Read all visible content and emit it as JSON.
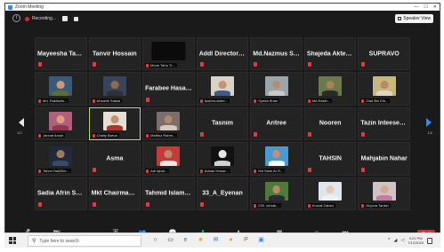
{
  "window": {
    "title": "Zoom Meeting"
  },
  "topbar": {
    "recording_label": "Recording...",
    "view_label": "Speaker View"
  },
  "gallery": {
    "tiles": [
      {
        "name": "Mayeesha Tasn...",
        "display": "text",
        "muted": true
      },
      {
        "name": "Tanvir Hossain",
        "display": "text",
        "muted": true
      },
      {
        "name": "Moon Tahu Tr...",
        "display": "video",
        "muted": true,
        "bg": "#0b0b0b",
        "skin": "#0b0b0b",
        "shirt": "#0b0b0b"
      },
      {
        "name": "Addl Director C...",
        "display": "text",
        "muted": true
      },
      {
        "name": "Md.Nazmus Sh...",
        "display": "text",
        "muted": true
      },
      {
        "name": "Shajeda Akter S...",
        "display": "text",
        "muted": true
      },
      {
        "name": "SUPRAVO",
        "display": "text",
        "muted": true
      },
      {
        "name": "Md. Rakibulis...",
        "display": "video",
        "muted": true,
        "bg": "#3b5a7a",
        "skin": "#c79a78",
        "shirt": "#5b6f3a"
      },
      {
        "name": "Ahsanik Saikat",
        "display": "video",
        "muted": true,
        "bg": "#36455a",
        "skin": "#8f6a4d",
        "shirt": "#2f2f3a"
      },
      {
        "name": "Farabee Hasan...",
        "display": "text",
        "muted": true
      },
      {
        "name": "Aashin-sister...",
        "display": "video",
        "muted": true,
        "bg": "#d9d2c6",
        "skin": "#c49574",
        "shirt": "#405a86"
      },
      {
        "name": "Syeda Khan",
        "display": "video",
        "muted": true,
        "bg": "#9aa4a9",
        "skin": "#b98b6a",
        "shirt": "#c8c8c8"
      },
      {
        "name": "Md.Rakib...",
        "display": "video",
        "muted": true,
        "bg": "#6a7a48",
        "skin": "#a8805e",
        "shirt": "#2a2a2a"
      },
      {
        "name": "Ziad Bin Elh...",
        "display": "video",
        "muted": true,
        "bg": "#c7b77a",
        "skin": "#b58a67",
        "shirt": "#e0d6c0"
      },
      {
        "name": "Jannat Arush",
        "display": "video",
        "muted": true,
        "bg": "#b0607a",
        "skin": "#d7a07e",
        "shirt": "#8a3a4a"
      },
      {
        "name": "Chaity Barua",
        "display": "video",
        "muted": true,
        "bg": "#e6e0d4",
        "skin": "#c9926f",
        "shirt": "#a33a2a",
        "active": true
      },
      {
        "name": "Mahfuz Rahm...",
        "display": "video",
        "muted": true,
        "bg": "#7c6e6a",
        "skin": "#b48866",
        "shirt": "#d4c9c0"
      },
      {
        "name": "Tasnim",
        "display": "text",
        "muted": true
      },
      {
        "name": "Aritree",
        "display": "text",
        "muted": true
      },
      {
        "name": "Nooren",
        "display": "text",
        "muted": true
      },
      {
        "name": "Tazin Inteeser (...",
        "display": "text",
        "muted": true
      },
      {
        "name": "Tahmi Ha&Elm...",
        "display": "video",
        "muted": true,
        "bg": "#1f2a3a",
        "skin": "#a07a5c",
        "shirt": "#3a4a6a"
      },
      {
        "name": "Asma",
        "display": "text",
        "muted": true
      },
      {
        "name": "Adi Iqbal...",
        "display": "video",
        "muted": true,
        "bg": "#c43a3a",
        "skin": "#b98a68",
        "shirt": "#f0e6e0"
      },
      {
        "name": "Adnan Hosse...",
        "display": "video",
        "muted": true,
        "bg": "#111111",
        "skin": "#e6e6e6",
        "shirt": "#d0d0d0"
      },
      {
        "name": "Md Saim Ar R...",
        "display": "video",
        "muted": true,
        "bg": "#4a9ad2",
        "skin": "#c29071",
        "shirt": "#ffffff"
      },
      {
        "name": "TAHSIN",
        "display": "text",
        "muted": true
      },
      {
        "name": "Mahjabin Nahar",
        "display": "text",
        "muted": true
      },
      {
        "name": "Sadia Afrin Swe...",
        "display": "text",
        "muted": true
      },
      {
        "name": "Mkt Chairman,...",
        "display": "text",
        "muted": true
      },
      {
        "name": "Tahmid Islam_62",
        "display": "text",
        "muted": true
      },
      {
        "name": "33_A_Eyenan",
        "display": "text",
        "muted": true
      },
      {
        "name": "033 -Ishrak...",
        "display": "video",
        "muted": true,
        "bg": "#4f7a3a",
        "skin": "#b78a6a",
        "shirt": "#2a2a3a"
      },
      {
        "name": "Kusrat Zahan",
        "display": "video",
        "muted": true,
        "bg": "#dfe7ee",
        "skin": "#e9c7b8",
        "shirt": "#f0f0f0"
      },
      {
        "name": "Nirjona Tanish",
        "display": "video",
        "muted": true,
        "bg": "#cfc3c9",
        "skin": "#d9a891",
        "shirt": "#c97aa0"
      }
    ]
  },
  "pager": {
    "left": "1/2",
    "right": "1/2"
  },
  "toolbar": {
    "items": [
      {
        "key": "unmute",
        "label": "Unmute",
        "icon": "mic-off-icon",
        "glyph": "🎤"
      },
      {
        "key": "video",
        "label": "Start Video",
        "icon": "video-off-icon",
        "glyph": "📷"
      },
      {
        "key": "security",
        "label": "Security",
        "icon": "shield-icon",
        "glyph": "⛨"
      },
      {
        "key": "participants",
        "label": "Participants",
        "icon": "participants-icon",
        "glyph": "👥"
      },
      {
        "key": "chat",
        "label": "Chat",
        "icon": "chat-icon",
        "glyph": "💬"
      },
      {
        "key": "share",
        "label": "Share Screen",
        "icon": "share-screen-icon",
        "glyph": "⬆"
      },
      {
        "key": "record",
        "label": "Pause/Stop Recording",
        "icon": "pause-stop-icon",
        "glyph": "⏸"
      },
      {
        "key": "breakout",
        "label": "Breakout Rooms",
        "icon": "breakout-rooms-icon",
        "glyph": "▦"
      },
      {
        "key": "reactions",
        "label": "Reactions",
        "icon": "reactions-icon",
        "glyph": "☺"
      },
      {
        "key": "more",
        "label": "More",
        "icon": "more-icon",
        "glyph": "•••"
      }
    ],
    "end_label": "End"
  },
  "taskbar": {
    "search_placeholder": "Type here to search",
    "time": "3:21 PM",
    "date": "7/12/2020",
    "apps": [
      {
        "name": "search-circle-icon",
        "glyph": "○",
        "color": "#333333"
      },
      {
        "name": "task-view-icon",
        "glyph": "▭",
        "color": "#333333"
      },
      {
        "name": "edge-icon",
        "glyph": "e",
        "color": "#1f7ad6"
      },
      {
        "name": "file-explorer-icon",
        "glyph": "■",
        "color": "#e8b53a"
      },
      {
        "name": "mail-icon",
        "glyph": "✉",
        "color": "#2a6fc9"
      },
      {
        "name": "chrome-icon",
        "glyph": "●",
        "color": "#e0a22a"
      },
      {
        "name": "powerpoint-icon",
        "glyph": "P",
        "color": "#c9482a"
      },
      {
        "name": "zoom-icon",
        "glyph": "▣",
        "color": "#2d8cff"
      }
    ]
  }
}
